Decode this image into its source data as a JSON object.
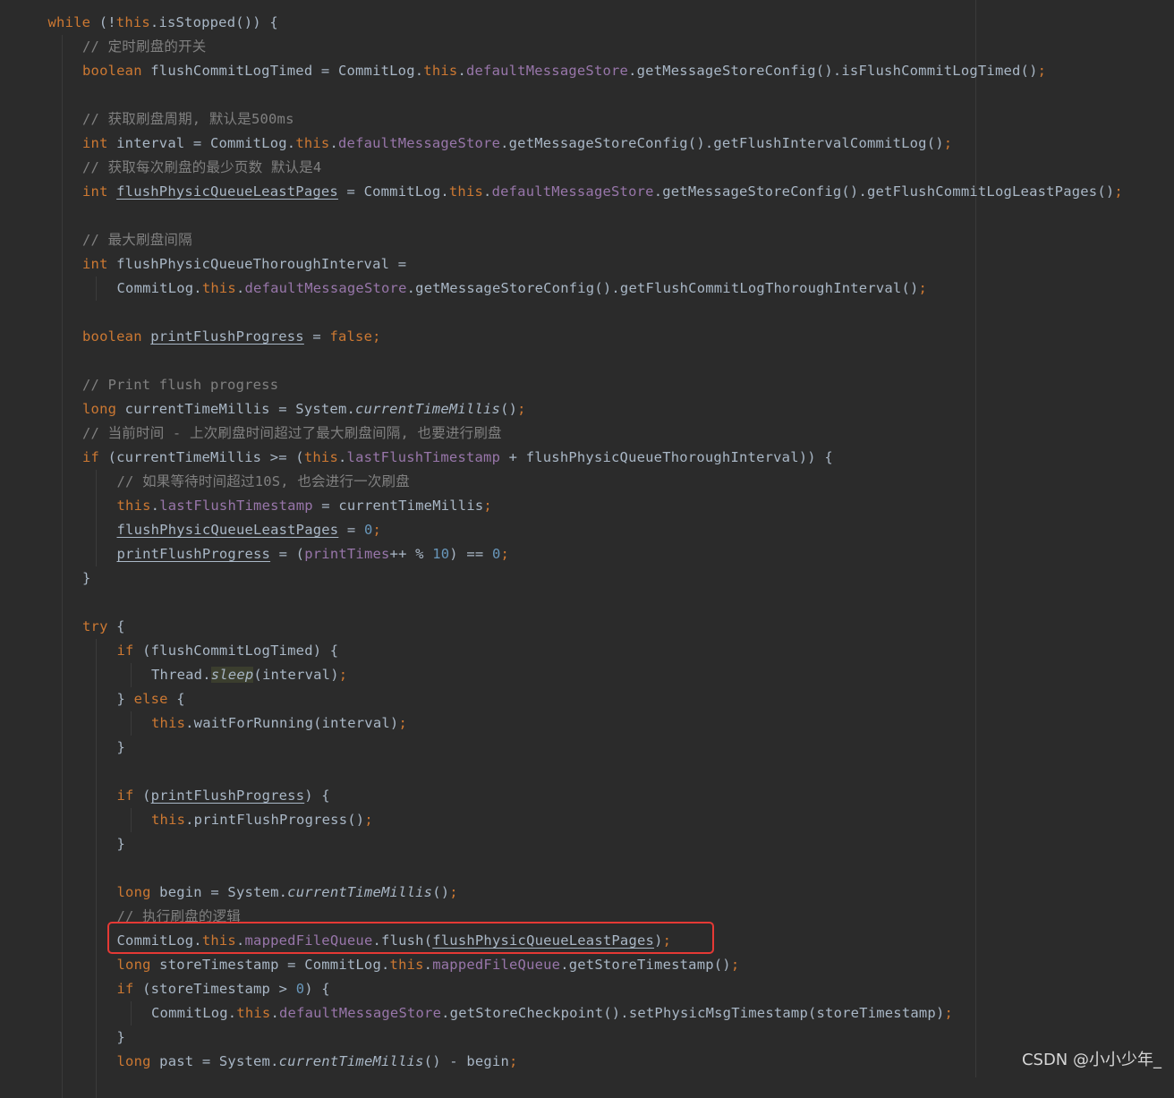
{
  "watermark": "CSDN @小小少年_",
  "code_lines": [
    {
      "indent": 1,
      "tokens": [
        [
          "kw",
          "while"
        ],
        [
          "plain",
          " (!"
        ],
        [
          "kw",
          "this"
        ],
        [
          "plain",
          ".isStopped()) {"
        ]
      ]
    },
    {
      "indent": 2,
      "tokens": [
        [
          "comment",
          "// 定时刷盘的开关"
        ]
      ]
    },
    {
      "indent": 2,
      "tokens": [
        [
          "kw",
          "boolean "
        ],
        [
          "plain",
          "flushCommitLogTimed = CommitLog."
        ],
        [
          "kw",
          "this"
        ],
        [
          "plain",
          "."
        ],
        [
          "field",
          "defaultMessageStore"
        ],
        [
          "plain",
          ".getMessageStoreConfig().isFlushCommitLogTimed()"
        ],
        [
          "kw",
          ";"
        ]
      ]
    },
    {
      "indent": 0,
      "tokens": []
    },
    {
      "indent": 2,
      "tokens": [
        [
          "comment",
          "// 获取刷盘周期, 默认是500ms"
        ]
      ]
    },
    {
      "indent": 2,
      "tokens": [
        [
          "kw",
          "int "
        ],
        [
          "plain",
          "interval = CommitLog."
        ],
        [
          "kw",
          "this"
        ],
        [
          "plain",
          "."
        ],
        [
          "field",
          "defaultMessageStore"
        ],
        [
          "plain",
          ".getMessageStoreConfig().getFlushIntervalCommitLog()"
        ],
        [
          "kw",
          ";"
        ]
      ]
    },
    {
      "indent": 2,
      "tokens": [
        [
          "comment",
          "// 获取每次刷盘的最少页数 默认是4"
        ]
      ]
    },
    {
      "indent": 2,
      "tokens": [
        [
          "kw",
          "int "
        ],
        [
          "ul",
          "flushPhysicQueueLeastPages"
        ],
        [
          "plain",
          " = CommitLog."
        ],
        [
          "kw",
          "this"
        ],
        [
          "plain",
          "."
        ],
        [
          "field",
          "defaultMessageStore"
        ],
        [
          "plain",
          ".getMessageStoreConfig().getFlushCommitLogLeastPages()"
        ],
        [
          "kw",
          ";"
        ]
      ]
    },
    {
      "indent": 0,
      "tokens": []
    },
    {
      "indent": 2,
      "tokens": [
        [
          "comment",
          "// 最大刷盘间隔"
        ]
      ]
    },
    {
      "indent": 2,
      "tokens": [
        [
          "kw",
          "int "
        ],
        [
          "plain",
          "flushPhysicQueueThoroughInterval ="
        ]
      ]
    },
    {
      "indent": 3,
      "tokens": [
        [
          "plain",
          "CommitLog."
        ],
        [
          "kw",
          "this"
        ],
        [
          "plain",
          "."
        ],
        [
          "field",
          "defaultMessageStore"
        ],
        [
          "plain",
          ".getMessageStoreConfig().getFlushCommitLogThoroughInterval()"
        ],
        [
          "kw",
          ";"
        ]
      ]
    },
    {
      "indent": 0,
      "tokens": []
    },
    {
      "indent": 2,
      "tokens": [
        [
          "kw",
          "boolean "
        ],
        [
          "ul",
          "printFlushProgress"
        ],
        [
          "plain",
          " = "
        ],
        [
          "kw",
          "false;"
        ]
      ]
    },
    {
      "indent": 0,
      "tokens": []
    },
    {
      "indent": 2,
      "tokens": [
        [
          "comment",
          "// Print flush progress"
        ]
      ]
    },
    {
      "indent": 2,
      "tokens": [
        [
          "kw",
          "long "
        ],
        [
          "plain",
          "currentTimeMillis = System."
        ],
        [
          "static",
          "currentTimeMillis"
        ],
        [
          "plain",
          "()"
        ],
        [
          "kw",
          ";"
        ]
      ]
    },
    {
      "indent": 2,
      "tokens": [
        [
          "comment",
          "// 当前时间 - 上次刷盘时间超过了最大刷盘间隔, 也要进行刷盘"
        ]
      ]
    },
    {
      "indent": 2,
      "tokens": [
        [
          "kw",
          "if "
        ],
        [
          "plain",
          "(currentTimeMillis >= ("
        ],
        [
          "kw",
          "this"
        ],
        [
          "plain",
          "."
        ],
        [
          "field",
          "lastFlushTimestamp"
        ],
        [
          "plain",
          " + flushPhysicQueueThoroughInterval)) {"
        ]
      ]
    },
    {
      "indent": 3,
      "tokens": [
        [
          "comment",
          "// 如果等待时间超过10S, 也会进行一次刷盘"
        ]
      ]
    },
    {
      "indent": 3,
      "tokens": [
        [
          "kw",
          "this"
        ],
        [
          "plain",
          "."
        ],
        [
          "field",
          "lastFlushTimestamp"
        ],
        [
          "plain",
          " = currentTimeMillis"
        ],
        [
          "kw",
          ";"
        ]
      ]
    },
    {
      "indent": 3,
      "tokens": [
        [
          "ul",
          "flushPhysicQueueLeastPages"
        ],
        [
          "plain",
          " = "
        ],
        [
          "num",
          "0"
        ],
        [
          "kw",
          ";"
        ]
      ]
    },
    {
      "indent": 3,
      "tokens": [
        [
          "ul",
          "printFlushProgress"
        ],
        [
          "plain",
          " = ("
        ],
        [
          "field",
          "printTimes"
        ],
        [
          "plain",
          "++ % "
        ],
        [
          "num",
          "10"
        ],
        [
          "plain",
          ") == "
        ],
        [
          "num",
          "0"
        ],
        [
          "kw",
          ";"
        ]
      ]
    },
    {
      "indent": 2,
      "tokens": [
        [
          "plain",
          "}"
        ]
      ]
    },
    {
      "indent": 0,
      "tokens": []
    },
    {
      "indent": 2,
      "tokens": [
        [
          "kw",
          "try "
        ],
        [
          "plain",
          "{"
        ]
      ]
    },
    {
      "indent": 3,
      "tokens": [
        [
          "kw",
          "if "
        ],
        [
          "plain",
          "(flushCommitLogTimed) {"
        ]
      ]
    },
    {
      "indent": 4,
      "tokens": [
        [
          "plain",
          "Thread."
        ],
        [
          "hl",
          "sleep"
        ],
        [
          "plain",
          "(interval)"
        ],
        [
          "kw",
          ";"
        ]
      ]
    },
    {
      "indent": 3,
      "tokens": [
        [
          "plain",
          "} "
        ],
        [
          "kw",
          "else "
        ],
        [
          "plain",
          "{"
        ]
      ]
    },
    {
      "indent": 4,
      "tokens": [
        [
          "kw",
          "this"
        ],
        [
          "plain",
          ".waitForRunning(interval)"
        ],
        [
          "kw",
          ";"
        ]
      ]
    },
    {
      "indent": 3,
      "tokens": [
        [
          "plain",
          "}"
        ]
      ]
    },
    {
      "indent": 0,
      "tokens": []
    },
    {
      "indent": 3,
      "tokens": [
        [
          "kw",
          "if "
        ],
        [
          "plain",
          "("
        ],
        [
          "ul",
          "printFlushProgress"
        ],
        [
          "plain",
          ") {"
        ]
      ]
    },
    {
      "indent": 4,
      "tokens": [
        [
          "kw",
          "this"
        ],
        [
          "plain",
          ".printFlushProgress()"
        ],
        [
          "kw",
          ";"
        ]
      ]
    },
    {
      "indent": 3,
      "tokens": [
        [
          "plain",
          "}"
        ]
      ]
    },
    {
      "indent": 0,
      "tokens": []
    },
    {
      "indent": 3,
      "tokens": [
        [
          "kw",
          "long "
        ],
        [
          "plain",
          "begin = System."
        ],
        [
          "static",
          "currentTimeMillis"
        ],
        [
          "plain",
          "()"
        ],
        [
          "kw",
          ";"
        ]
      ]
    },
    {
      "indent": 3,
      "tokens": [
        [
          "comment",
          "// 执行刷盘的逻辑"
        ]
      ]
    },
    {
      "indent": 3,
      "tokens": [
        [
          "plain",
          "CommitLog."
        ],
        [
          "kw",
          "this"
        ],
        [
          "plain",
          "."
        ],
        [
          "field",
          "mappedFileQueue"
        ],
        [
          "plain",
          ".flush("
        ],
        [
          "ul",
          "flushPhysicQueueLeastPages"
        ],
        [
          "plain",
          ")"
        ],
        [
          "kw",
          ";"
        ]
      ]
    },
    {
      "indent": 3,
      "tokens": [
        [
          "kw",
          "long "
        ],
        [
          "plain",
          "storeTimestamp = CommitLog."
        ],
        [
          "kw",
          "this"
        ],
        [
          "plain",
          "."
        ],
        [
          "field",
          "mappedFileQueue"
        ],
        [
          "plain",
          ".getStoreTimestamp()"
        ],
        [
          "kw",
          ";"
        ]
      ]
    },
    {
      "indent": 3,
      "tokens": [
        [
          "kw",
          "if "
        ],
        [
          "plain",
          "(storeTimestamp > "
        ],
        [
          "num",
          "0"
        ],
        [
          "plain",
          ") {"
        ]
      ]
    },
    {
      "indent": 4,
      "tokens": [
        [
          "plain",
          "CommitLog."
        ],
        [
          "kw",
          "this"
        ],
        [
          "plain",
          "."
        ],
        [
          "field",
          "defaultMessageStore"
        ],
        [
          "plain",
          ".getStoreCheckpoint().setPhysicMsgTimestamp(storeTimestamp)"
        ],
        [
          "kw",
          ";"
        ]
      ]
    },
    {
      "indent": 3,
      "tokens": [
        [
          "plain",
          "}"
        ]
      ]
    },
    {
      "indent": 3,
      "tokens": [
        [
          "kw",
          "long "
        ],
        [
          "plain",
          "past = System."
        ],
        [
          "static",
          "currentTimeMillis"
        ],
        [
          "plain",
          "() - begin"
        ],
        [
          "kw",
          ";"
        ]
      ]
    }
  ]
}
